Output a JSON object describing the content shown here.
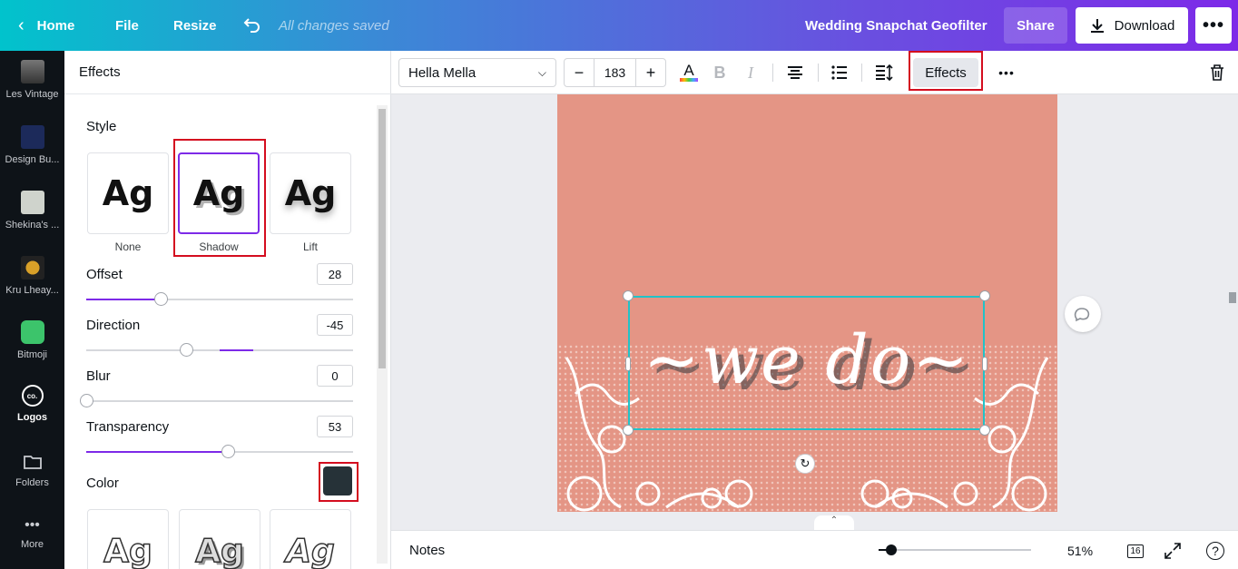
{
  "topbar": {
    "home_label": "Home",
    "file_label": "File",
    "resize_label": "Resize",
    "save_status": "All changes saved",
    "design_title": "Wedding Snapchat Geofilter",
    "share_label": "Share",
    "download_label": "Download"
  },
  "rail": {
    "items": [
      {
        "label": "Les Vintage"
      },
      {
        "label": "Design Bu..."
      },
      {
        "label": "Shekina's ..."
      },
      {
        "label": "Kru Lheay..."
      },
      {
        "label": "Bitmoji"
      },
      {
        "label": "Logos"
      },
      {
        "label": "Folders"
      },
      {
        "label": "More"
      }
    ]
  },
  "panel": {
    "title": "Effects",
    "style_heading": "Style",
    "styles": [
      {
        "sample": "Ag",
        "label": "None"
      },
      {
        "sample": "Ag",
        "label": "Shadow"
      },
      {
        "sample": "Ag",
        "label": "Lift"
      }
    ],
    "selected_style": "Shadow",
    "offset": {
      "label": "Offset",
      "value": "28",
      "level": 0.28
    },
    "direction": {
      "label": "Direction",
      "value": "-45",
      "level": 0.375
    },
    "blur": {
      "label": "Blur",
      "value": "0",
      "level": 0
    },
    "transparency": {
      "label": "Transparency",
      "value": "53",
      "level": 0.53
    },
    "color_label": "Color",
    "shadow_color": "#263238",
    "presets": [
      {
        "sample": "Ag"
      },
      {
        "sample": "Ag"
      },
      {
        "sample": "Ag"
      }
    ]
  },
  "toolbar": {
    "font_name": "Hella Mella",
    "font_size": "183",
    "decrease_label": "−",
    "increase_label": "+",
    "bold_label": "B",
    "italic_label": "I",
    "effects_label": "Effects"
  },
  "canvas": {
    "page_background": "#e49585",
    "text_content": "~we do~",
    "text_color": "#ffffff",
    "selection_color": "#22c2c8"
  },
  "bottombar": {
    "notes_label": "Notes",
    "zoom_value": "51%",
    "zoom_level": 0.04,
    "page_count": "16",
    "help_label": "?"
  },
  "colors": {
    "accent": "#7d2ae8",
    "highlight_red": "#d40d1f"
  }
}
